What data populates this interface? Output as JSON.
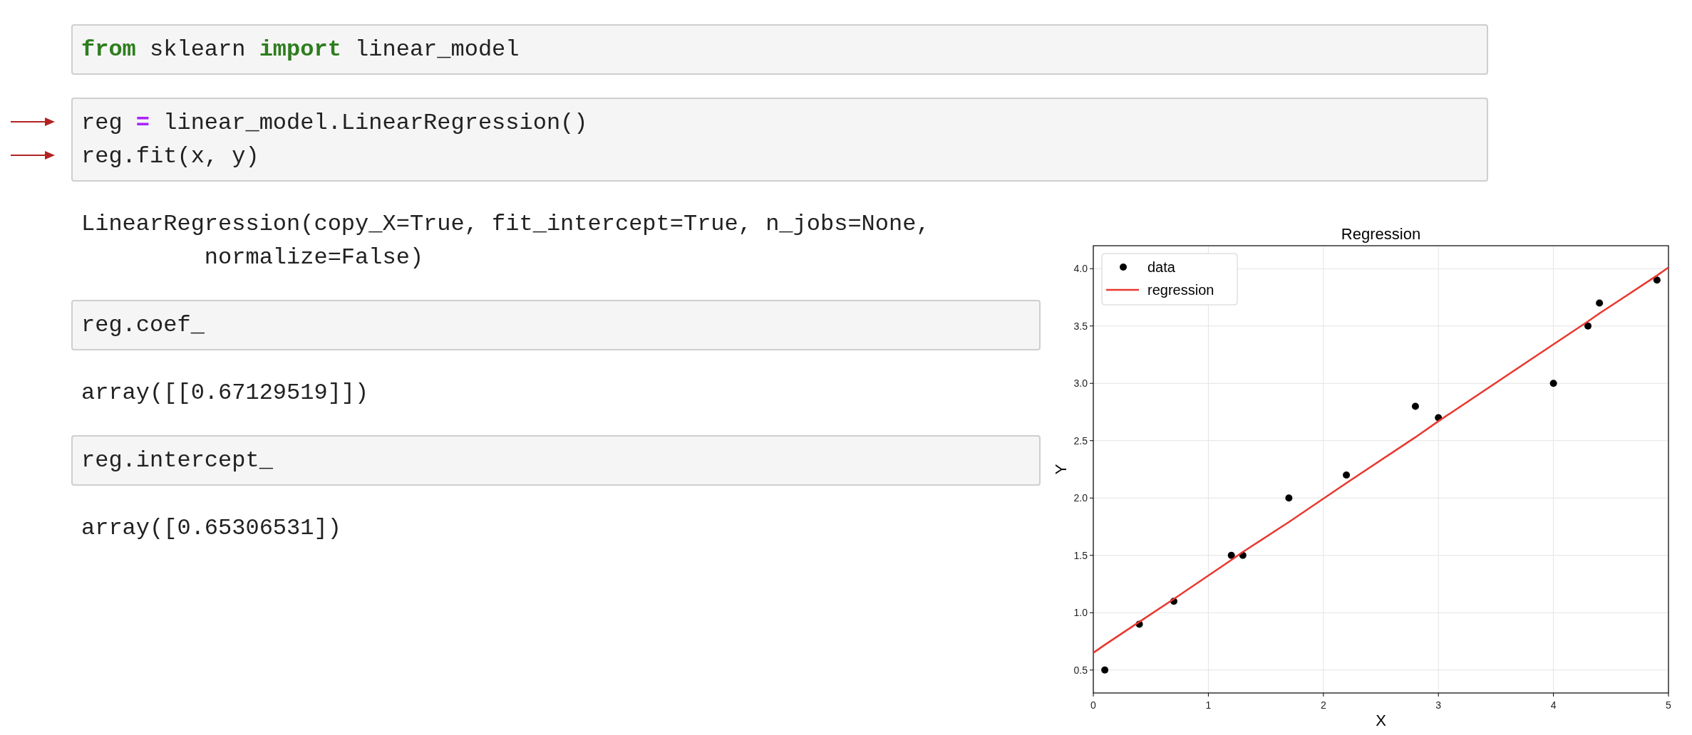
{
  "cells": [
    {
      "kind": "input",
      "lines": [
        {
          "arrow": false,
          "segments": [
            {
              "kind": "keyword",
              "text": "from"
            },
            {
              "kind": "plain",
              "text": " sklearn "
            },
            {
              "kind": "keyword",
              "text": "import"
            },
            {
              "kind": "plain",
              "text": " linear_model"
            }
          ]
        }
      ]
    },
    {
      "kind": "input",
      "lines": [
        {
          "arrow": true,
          "segments": [
            {
              "kind": "plain",
              "text": "reg "
            },
            {
              "kind": "operator",
              "text": "="
            },
            {
              "kind": "plain",
              "text": " linear_model.LinearRegression()"
            }
          ]
        },
        {
          "arrow": true,
          "segments": [
            {
              "kind": "plain",
              "text": "reg.fit(x, y)"
            }
          ]
        }
      ]
    },
    {
      "kind": "output",
      "lines": [
        "LinearRegression(copy_X=True, fit_intercept=True, n_jobs=None,",
        "         normalize=False)"
      ]
    },
    {
      "kind": "input",
      "lines": [
        {
          "arrow": false,
          "segments": [
            {
              "kind": "plain",
              "text": "reg.coef_"
            }
          ]
        }
      ]
    },
    {
      "kind": "output",
      "lines": [
        "array([[0.67129519]])"
      ]
    },
    {
      "kind": "input",
      "lines": [
        {
          "arrow": false,
          "segments": [
            {
              "kind": "plain",
              "text": "reg.intercept_"
            }
          ]
        }
      ]
    },
    {
      "kind": "output",
      "lines": [
        "array([0.65306531])"
      ]
    }
  ],
  "figure": {
    "chart_data": {
      "type": "scatter",
      "title": "Regression",
      "xlabel": "X",
      "ylabel": "Y",
      "x": [
        0,
        0.1,
        0.4,
        0.7,
        1.2,
        1.3,
        1.7,
        2.2,
        2.8,
        3.0,
        4.0,
        4.3,
        4.4,
        4.9,
        5
      ],
      "series": [
        {
          "name": "data",
          "type": "scatter",
          "color": "#000000",
          "values": [
            null,
            0.5,
            0.9,
            1.1,
            1.5,
            1.5,
            2.0,
            2.2,
            2.8,
            2.7,
            3.0,
            3.5,
            3.7,
            3.9,
            null
          ]
        },
        {
          "name": "regression",
          "type": "line",
          "color": "#e8382e",
          "values": [
            0.65,
            0.72,
            0.92,
            1.12,
            1.46,
            1.53,
            1.79,
            2.13,
            2.53,
            2.67,
            3.34,
            3.54,
            3.61,
            3.94,
            4.01
          ]
        }
      ],
      "grid": true,
      "legend": true,
      "xlim": [
        0,
        5
      ],
      "ylim": [
        0.3,
        4.2
      ],
      "xticks": [
        0,
        1,
        2,
        3,
        4,
        5
      ],
      "yticks": [
        {
          "value": 0.5,
          "label": "0.5"
        },
        {
          "value": 1,
          "label": "1.0"
        },
        {
          "value": 1.5,
          "label": "1.5"
        },
        {
          "value": 2,
          "label": "2.0"
        },
        {
          "value": 2.5,
          "label": "2.5"
        },
        {
          "value": 3,
          "label": "3.0"
        },
        {
          "value": 3.5,
          "label": "3.5"
        },
        {
          "value": 4,
          "label": "4.0"
        }
      ]
    }
  }
}
